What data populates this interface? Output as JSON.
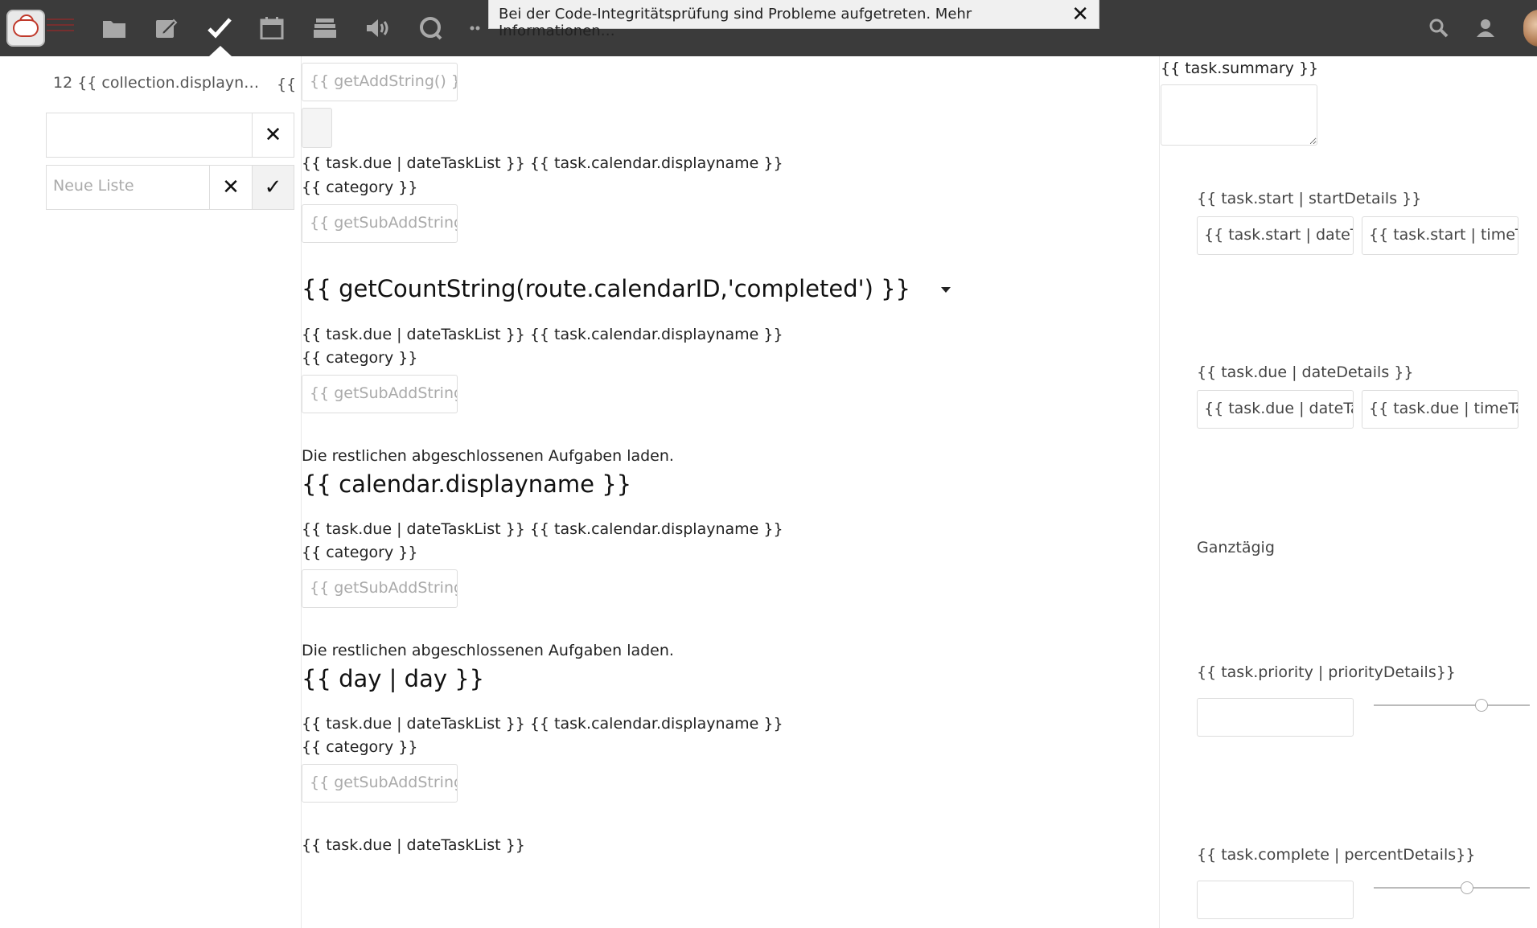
{
  "app": {
    "notification": "Bei der Code-Integritätsprüfung sind Probleme aufgetreten. Mehr Informationen…",
    "notification_close": "✕",
    "nav_icons": [
      "files-icon",
      "notes-icon",
      "tasks-icon",
      "calendar-icon",
      "stack-icon",
      "audio-icon",
      "chat-icon",
      "more-icon"
    ],
    "right_icons": [
      "search-icon",
      "contacts-icon"
    ]
  },
  "sidebar": {
    "collection_label": "12 {{ collection.displayn…",
    "collection_extra": "{{",
    "search_value": "",
    "clear_symbol": "✕",
    "new_list_placeholder": "Neue Liste",
    "cancel_symbol": "✕",
    "confirm_symbol": "✓"
  },
  "main": {
    "add_placeholder": "{{ getAddString() }}",
    "task_meta": "{{ task.due | dateTaskList }} {{ task.calendar.displayname }}",
    "category": "{{ category }}",
    "sub_add_placeholder": "{{ getSubAddString(t",
    "count_heading": "{{ getCountString(route.calendarID,'completed') }}",
    "load_more": "Die restlichen abgeschlossenen Aufgaben laden.",
    "calendar_heading": "{{ calendar.displayname }}",
    "day_heading": "{{ day | day }}",
    "last_line": "{{ task.due | dateTaskList }}"
  },
  "details": {
    "summary_label": "{{ task.summary }}",
    "start_label": "{{ task.start | startDetails }}",
    "start_date": "{{ task.start | dateTa",
    "start_time": "{{ task.start | timeTa",
    "due_label": "{{ task.due | dateDetails }}",
    "due_date": "{{ task.due | dateTa:",
    "due_time": "{{ task.due | timeTa:",
    "allday": "Ganztägig",
    "priority_label": "{{ task.priority | priorityDetails}}",
    "priority_value": 0.69,
    "complete_label": "{{ task.complete | percentDetails}}",
    "complete_value": 0.6
  }
}
